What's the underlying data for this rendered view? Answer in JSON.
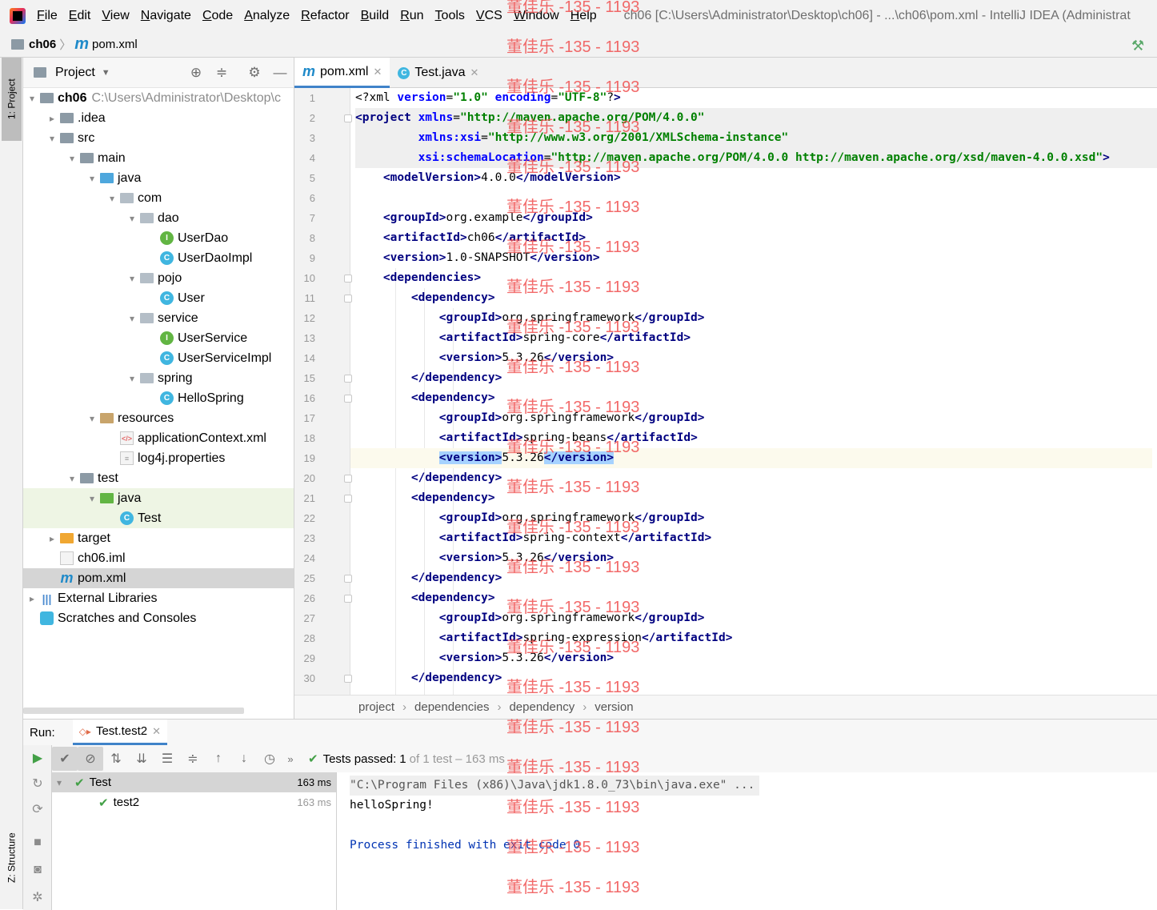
{
  "menubar": {
    "items": [
      "File",
      "Edit",
      "View",
      "Navigate",
      "Code",
      "Analyze",
      "Refactor",
      "Build",
      "Run",
      "Tools",
      "VCS",
      "Window",
      "Help"
    ],
    "window_title": "ch06 [C:\\Users\\Administrator\\Desktop\\ch06] - ...\\ch06\\pom.xml - IntelliJ IDEA (Administrat"
  },
  "navbar": {
    "project": "ch06",
    "file": "pom.xml"
  },
  "side_tabs": {
    "project": "1: Project",
    "structure": "Z: Structure"
  },
  "project_panel": {
    "title": "Project",
    "tree": [
      {
        "label": "ch06",
        "path": "C:\\Users\\Administrator\\Desktop\\c",
        "icon": "folder",
        "arrow": "▾",
        "bold": true
      },
      {
        "label": ".idea",
        "icon": "folder",
        "arrow": "▸"
      },
      {
        "label": "src",
        "icon": "folder",
        "arrow": "▾"
      },
      {
        "label": "main",
        "icon": "folder",
        "arrow": "▾"
      },
      {
        "label": "java",
        "icon": "folder-src",
        "arrow": "▾"
      },
      {
        "label": "com",
        "icon": "pkg",
        "arrow": "▾"
      },
      {
        "label": "dao",
        "icon": "pkg",
        "arrow": "▾"
      },
      {
        "label": "UserDao",
        "icon": "iface",
        "arrow": ""
      },
      {
        "label": "UserDaoImpl",
        "icon": "cls",
        "arrow": ""
      },
      {
        "label": "pojo",
        "icon": "pkg",
        "arrow": "▾"
      },
      {
        "label": "User",
        "icon": "cls",
        "arrow": ""
      },
      {
        "label": "service",
        "icon": "pkg",
        "arrow": "▾"
      },
      {
        "label": "UserService",
        "icon": "iface",
        "arrow": ""
      },
      {
        "label": "UserServiceImpl",
        "icon": "cls",
        "arrow": ""
      },
      {
        "label": "spring",
        "icon": "pkg",
        "arrow": "▾"
      },
      {
        "label": "HelloSpring",
        "icon": "cls",
        "arrow": ""
      },
      {
        "label": "resources",
        "icon": "folder-res",
        "arrow": "▾"
      },
      {
        "label": "applicationContext.xml",
        "icon": "xml",
        "arrow": ""
      },
      {
        "label": "log4j.properties",
        "icon": "prop",
        "arrow": ""
      },
      {
        "label": "test",
        "icon": "folder",
        "arrow": "▾"
      },
      {
        "label": "java",
        "icon": "folder-test",
        "arrow": "▾"
      },
      {
        "label": "Test",
        "icon": "cls",
        "arrow": ""
      },
      {
        "label": "target",
        "icon": "folder-target",
        "arrow": "▸"
      },
      {
        "label": "ch06.iml",
        "icon": "iml",
        "arrow": ""
      },
      {
        "label": "pom.xml",
        "icon": "pom",
        "arrow": ""
      },
      {
        "label": "External Libraries",
        "icon": "lib",
        "arrow": "▸"
      },
      {
        "label": "Scratches and Consoles",
        "icon": "scr",
        "arrow": ""
      }
    ]
  },
  "editor": {
    "tabs": [
      {
        "label": "pom.xml",
        "active": true,
        "icon": "m"
      },
      {
        "label": "Test.java",
        "active": false,
        "icon": "C"
      }
    ],
    "lines": [
      "<?xml version=\"1.0\" encoding=\"UTF-8\"?>",
      "<project xmlns=\"http://maven.apache.org/POM/4.0.0\"",
      "         xmlns:xsi=\"http://www.w3.org/2001/XMLSchema-instance\"",
      "         xsi:schemaLocation=\"http://maven.apache.org/POM/4.0.0 http://maven.apache.org/xsd/maven-4.0.0.xsd\">",
      "    <modelVersion>4.0.0</modelVersion>",
      "",
      "    <groupId>org.example</groupId>",
      "    <artifactId>ch06</artifactId>",
      "    <version>1.0-SNAPSHOT</version>",
      "    <dependencies>",
      "        <dependency>",
      "            <groupId>org.springframework</groupId>",
      "            <artifactId>spring-core</artifactId>",
      "            <version>5.3.26</version>",
      "        </dependency>",
      "        <dependency>",
      "            <groupId>org.springframework</groupId>",
      "            <artifactId>spring-beans</artifactId>",
      "            <version>5.3.26</version>",
      "        </dependency>",
      "        <dependency>",
      "            <groupId>org.springframework</groupId>",
      "            <artifactId>spring-context</artifactId>",
      "            <version>5.3.26</version>",
      "        </dependency>",
      "        <dependency>",
      "            <groupId>org.springframework</groupId>",
      "            <artifactId>spring-expression</artifactId>",
      "            <version>5.3.26</version>",
      "        </dependency>"
    ],
    "current_line": 19,
    "breadcrumbs": [
      "project",
      "dependencies",
      "dependency",
      "version"
    ]
  },
  "run": {
    "label": "Run:",
    "tab": "Test.test2",
    "status_prefix": "Tests passed:",
    "status_count": "1",
    "status_rest": "of 1 test – 163 ms",
    "tests": [
      {
        "name": "Test",
        "time": "163 ms"
      },
      {
        "name": "test2",
        "time": "163 ms"
      }
    ],
    "console": [
      "\"C:\\Program Files (x86)\\Java\\jdk1.8.0_73\\bin\\java.exe\" ...",
      "helloSpring!",
      "",
      "Process finished with exit code 0"
    ]
  },
  "watermark": "董佳乐 -135 - 1193"
}
